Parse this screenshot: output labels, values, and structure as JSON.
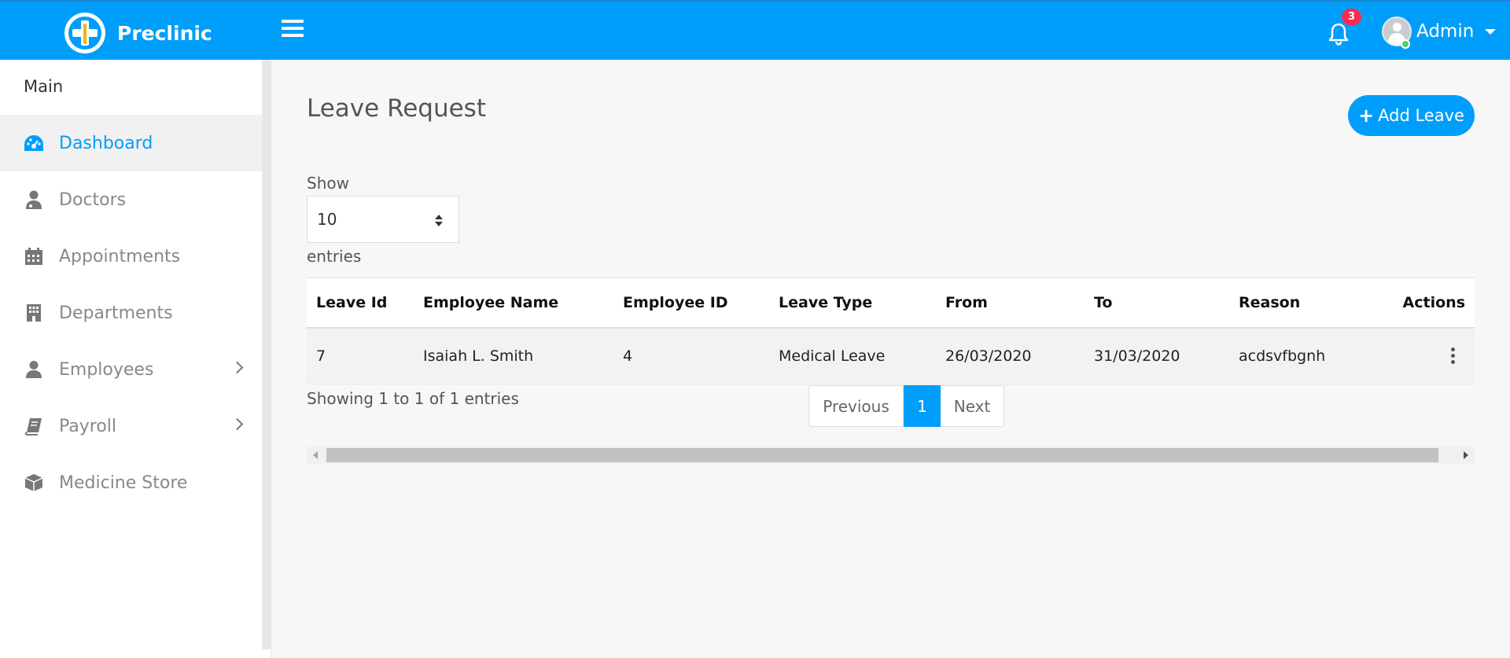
{
  "header": {
    "app_name": "Preclinic",
    "notification_count": "3",
    "user_name": "Admin",
    "brand_color": "#009efb",
    "badge_color": "#f62d51",
    "online_color": "#55ce63"
  },
  "sidebar": {
    "title": "Main",
    "items": [
      {
        "label": "Dashboard",
        "icon": "dashboard-icon",
        "active": true
      },
      {
        "label": "Doctors",
        "icon": "doctor-icon"
      },
      {
        "label": "Appointments",
        "icon": "calendar-icon"
      },
      {
        "label": "Departments",
        "icon": "building-icon"
      },
      {
        "label": "Employees",
        "icon": "user-icon",
        "has_submenu": true
      },
      {
        "label": "Payroll",
        "icon": "book-icon",
        "has_submenu": true
      },
      {
        "label": "Medicine Store",
        "icon": "cube-icon"
      }
    ]
  },
  "main": {
    "title": "Leave Request",
    "add_button": "Add Leave",
    "show_label": "Show",
    "page_size": "10",
    "entries_label": "entries",
    "info": "Showing 1 to 1 of 1 entries"
  },
  "table": {
    "columns": [
      "Leave Id",
      "Employee Name",
      "Employee ID",
      "Leave Type",
      "From",
      "To",
      "Reason",
      "Actions"
    ],
    "rows": [
      [
        "7",
        "Isaiah L. Smith",
        "4",
        "Medical Leave",
        "26/03/2020",
        "31/03/2020",
        "acdsvfbgnh"
      ]
    ]
  },
  "pagination": {
    "previous": "Previous",
    "current": "1",
    "next": "Next"
  }
}
